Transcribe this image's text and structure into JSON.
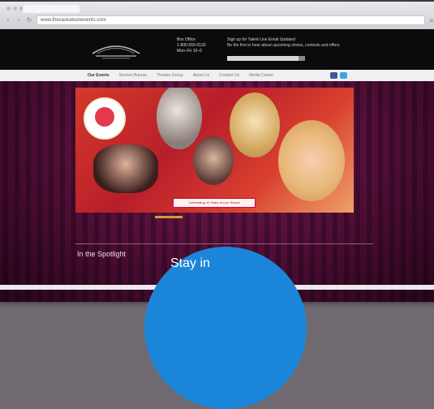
{
  "browser": {
    "url": "www.thesaskatoonevents.com"
  },
  "header": {
    "box_office": {
      "title": "Box Office",
      "phone": "1-800-555-0133",
      "hours": "Mon–Fri 10–6"
    },
    "promo": {
      "title": "Sign up for Talent Live Email Updates!",
      "text": "Be the first to hear about upcoming shows, contests and offers."
    }
  },
  "nav": {
    "items": [
      "Our Events",
      "Seniors Bureau",
      "Theatre Group",
      "About Us",
      "Contact Us",
      "Media Center"
    ],
    "active_index": 0
  },
  "colors": {
    "accent": "#1b86d9",
    "twitter": "#3aa8e0",
    "facebook": "#3b5998"
  },
  "hero": {
    "caption": "Celebrating 10 Years of Live Shows"
  },
  "spotlight": {
    "title": "In the Spotlight"
  },
  "cta": {
    "text": "Stay in"
  }
}
